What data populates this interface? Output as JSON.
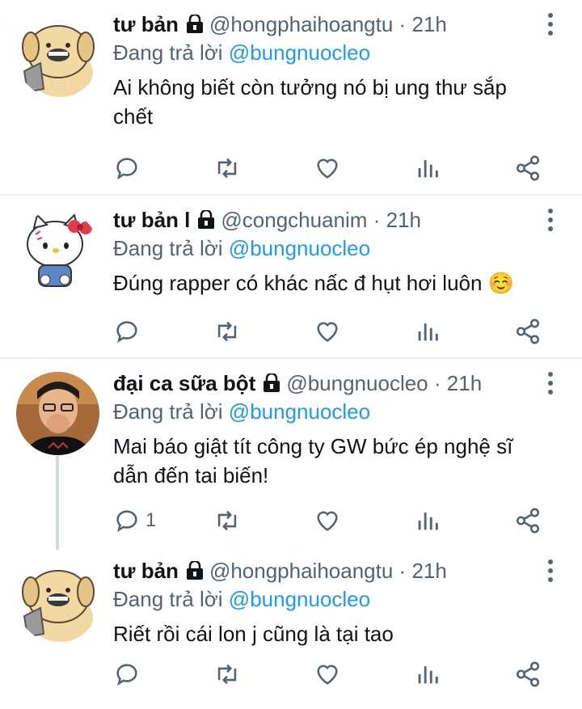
{
  "tweets": [
    {
      "name": "tư bản",
      "handle": "@hongphaihoangtu",
      "dot": "·",
      "time": "21h",
      "reply_prefix": "Đang trả lời",
      "reply_to": "@bungnuocleo",
      "text": "Ai không biết còn tưởng nó bị ung thư sắp chết",
      "avatar": "dog-avatar",
      "reply_count": ""
    },
    {
      "name": "tư bản l",
      "handle": "@congchuanim",
      "dot": "·",
      "time": "21h",
      "reply_prefix": "Đang trả lời",
      "reply_to": "@bungnuocleo",
      "text": "Đúng rapper có khác nấc đ hụt hơi luôn ☺️",
      "avatar": "hello-kitty-avatar",
      "reply_count": ""
    },
    {
      "name": "đại ca sữa bột",
      "handle": "@bungnuocleo",
      "dot": "·",
      "time": "21h",
      "reply_prefix": "Đang trả lời",
      "reply_to": "@bungnuocleo",
      "text": "Mai báo giật tít công ty GW bức ép nghệ sĩ dẫn đến tai biến!",
      "avatar": "person-photo-avatar",
      "reply_count": "1"
    },
    {
      "name": "tư bản",
      "handle": "@hongphaihoangtu",
      "dot": "·",
      "time": "21h",
      "reply_prefix": "Đang trả lời",
      "reply_to": "@bungnuocleo",
      "text": "Riết rồi cái lon j cũng là tại tao",
      "avatar": "dog-avatar",
      "reply_count": ""
    }
  ],
  "colors": {
    "mention": "#1d9bf0",
    "secondary_text": "#536471",
    "divider": "#e6ecf0",
    "thread_line": "#cfd9de"
  }
}
